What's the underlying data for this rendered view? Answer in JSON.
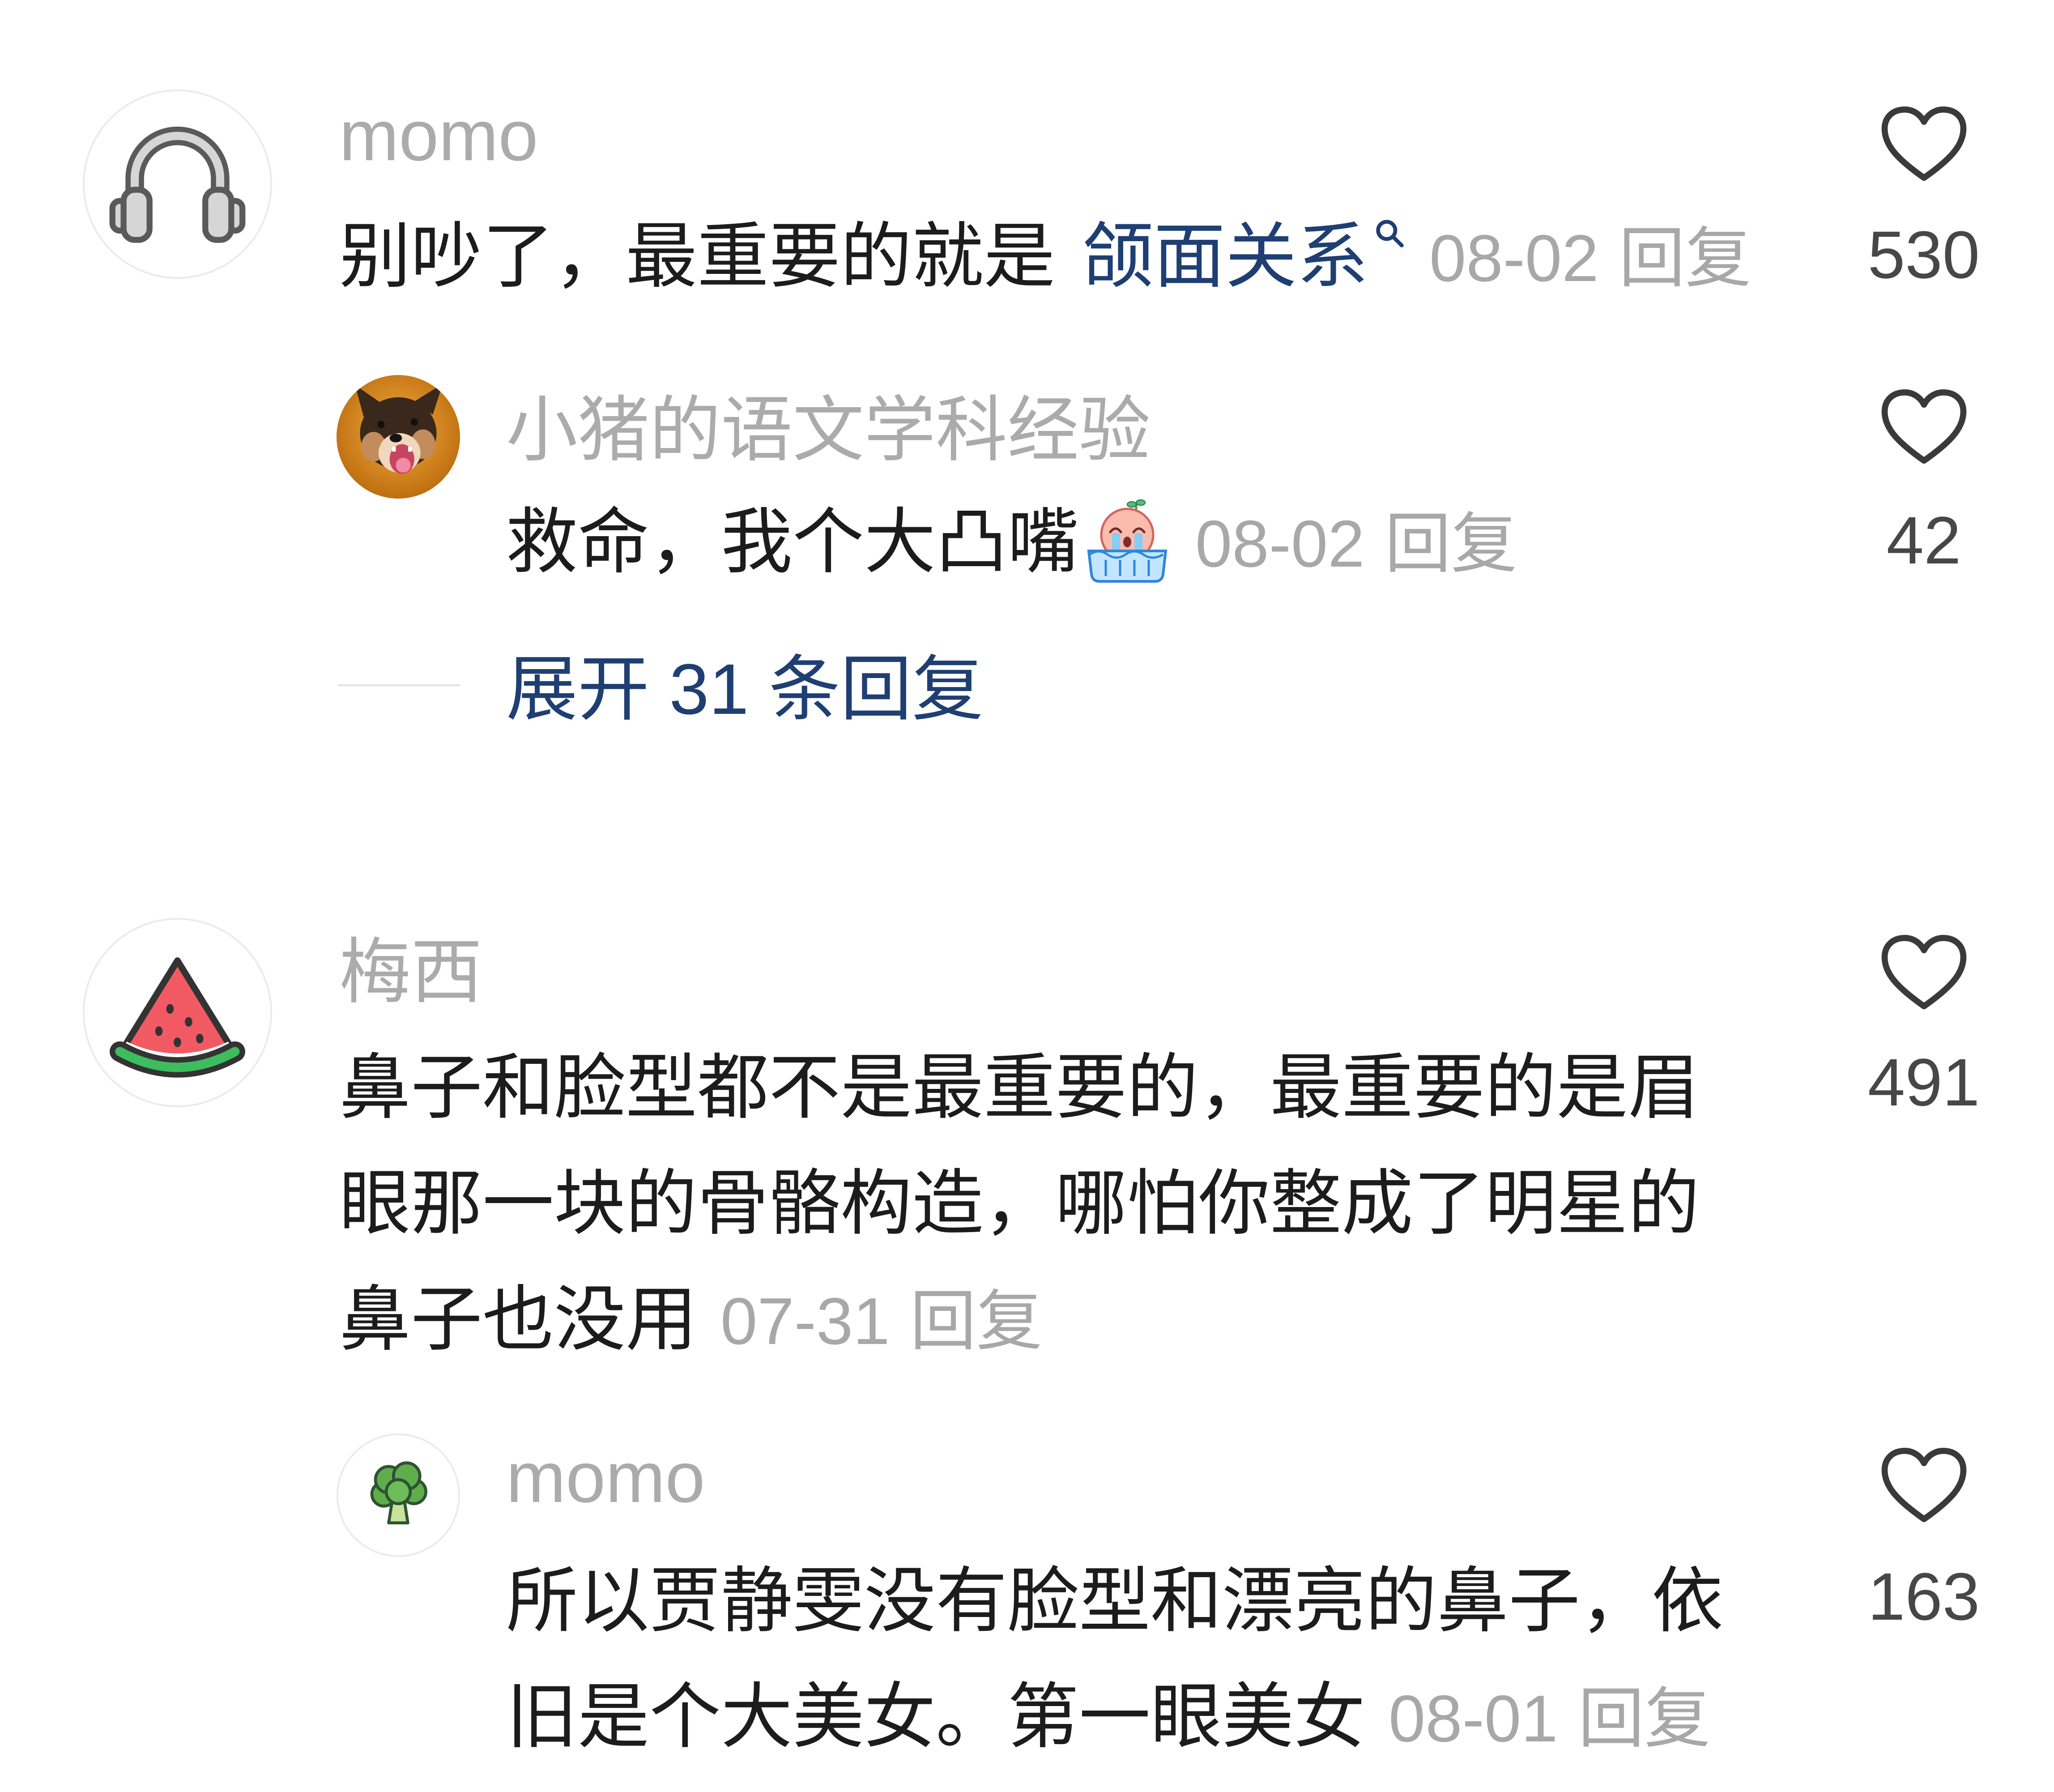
{
  "comments": [
    {
      "username": "momo",
      "avatar_icon": "headphones-icon",
      "text": "别吵了，最重要的就是",
      "link_text": "颌面关系",
      "link_icon": "search-icon",
      "date": "08-02",
      "reply_label": "回复",
      "likes": "530",
      "replies": [
        {
          "username": "小猪的语文学科经验",
          "avatar_icon": "dog-photo-avatar",
          "text": "救命，我个大凸嘴",
          "emoji": "crying-in-tub-emoji",
          "date": "08-02",
          "reply_label": "回复",
          "likes": "42"
        }
      ],
      "expand_label": "展开 31 条回复"
    },
    {
      "username": "梅西",
      "avatar_icon": "watermelon-icon",
      "text": "鼻子和脸型都不是最重要的，最重要的是眉眼那一块的骨骼构造，哪怕你整成了明星的鼻子也没用",
      "date": "07-31",
      "reply_label": "回复",
      "likes": "491",
      "replies": [
        {
          "username": "momo",
          "avatar_icon": "broccoli-icon",
          "text": "所以贾静雯没有脸型和漂亮的鼻子，依旧是个大美女。第一眼美女",
          "date": "08-01",
          "reply_label": "回复",
          "likes": "163"
        }
      ]
    }
  ],
  "colors": {
    "username": "#ababab",
    "text": "#1c1c1c",
    "meta": "#a8a8a8",
    "link": "#1f3f73",
    "count": "#474747",
    "heart": "#3a3a3a",
    "divider": "#e2e2e2"
  }
}
